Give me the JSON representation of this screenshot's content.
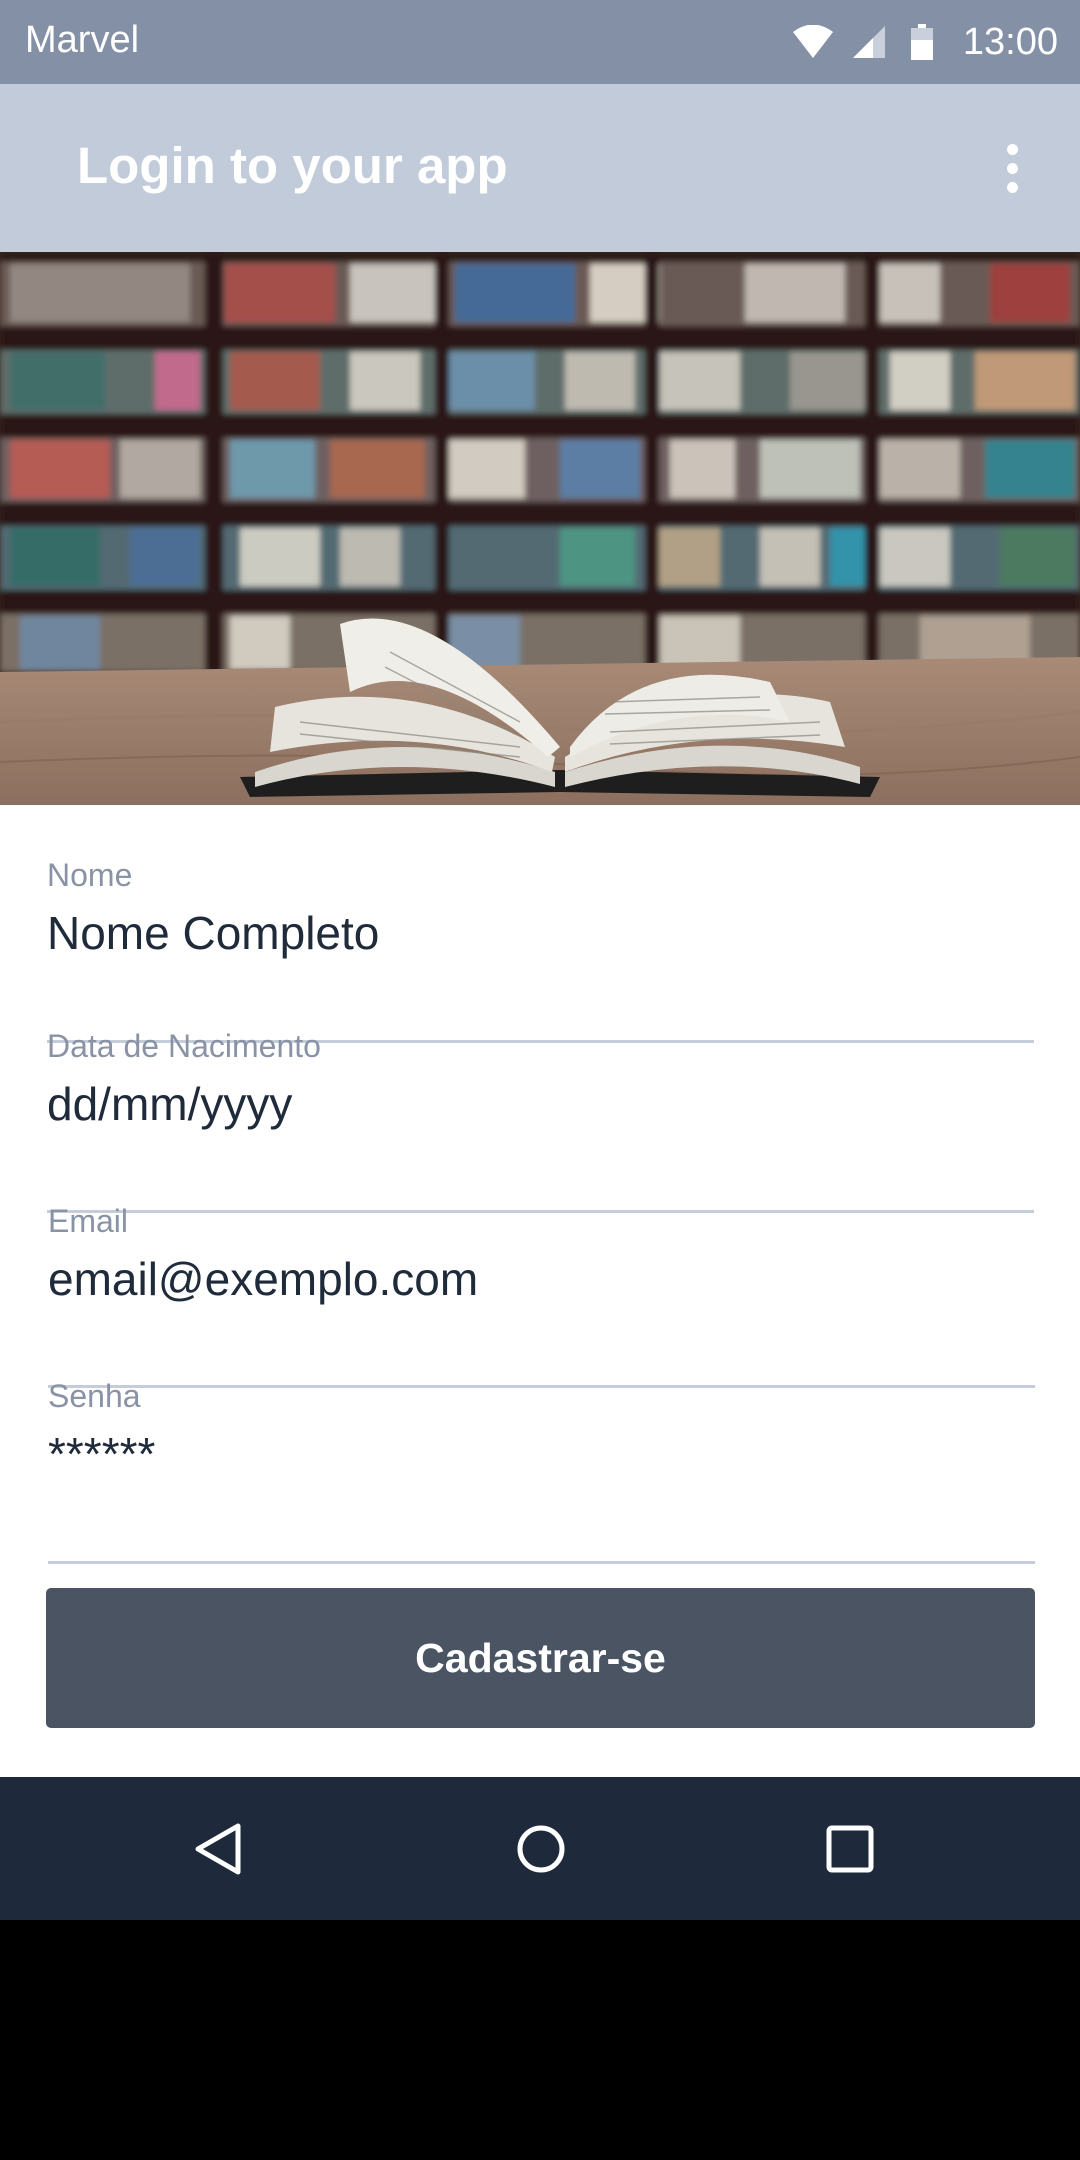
{
  "statusbar": {
    "carrier": "Marvel",
    "time": "13:00",
    "icons": [
      "wifi-icon",
      "cell-signal-icon",
      "battery-icon"
    ]
  },
  "appbar": {
    "title": "Login to your app",
    "overflow_icon": "more-vert-icon"
  },
  "hero": {
    "image": "open-book-on-table-library-background"
  },
  "form": {
    "fields": [
      {
        "label": "Nome",
        "value": "Nome Completo"
      },
      {
        "label": "Data de Nacimento",
        "value": "dd/mm/yyyy"
      },
      {
        "label": "Email",
        "value": "email@exemplo.com"
      },
      {
        "label": "Senha",
        "value": "******"
      }
    ],
    "submit_label": "Cadastrar-se"
  },
  "navbar": {
    "icons": [
      "back-icon",
      "home-icon",
      "recents-icon"
    ]
  },
  "colors": {
    "statusbar": "#8390a5",
    "appbar": "#c1cbd9",
    "button": "#4a5462",
    "navbar": "#1e2a3b"
  }
}
